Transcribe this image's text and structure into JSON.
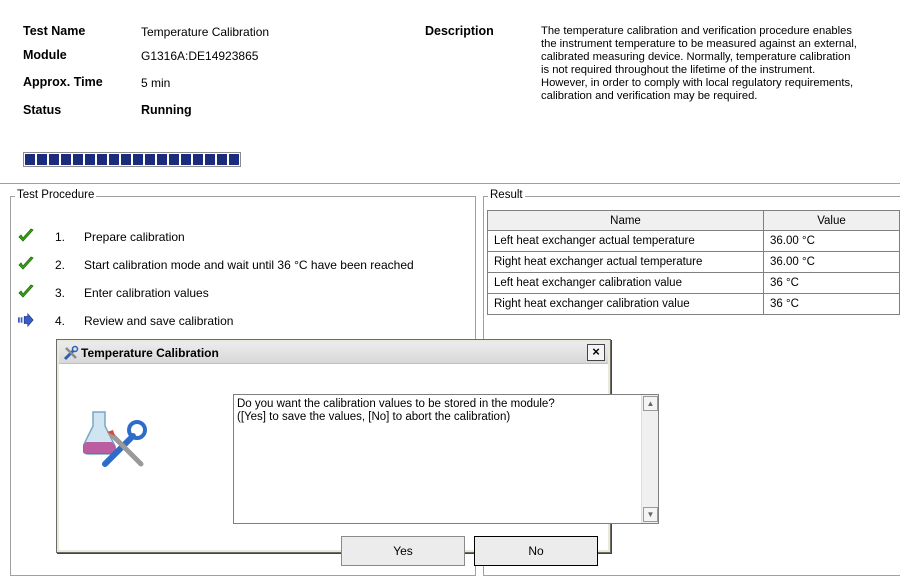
{
  "header": {
    "test_name_label": "Test Name",
    "test_name_value": "Temperature Calibration",
    "module_label": "Module",
    "module_value": "G1316A:DE14923865",
    "time_label": "Approx. Time",
    "time_value": "5 min",
    "status_label": "Status",
    "status_value": "Running",
    "description_label": "Description",
    "description_lines": [
      "The temperature calibration and verification procedure enables",
      "the instrument temperature to be measured against an external,",
      "calibrated measuring device. Normally, temperature calibration",
      "is not required throughout the lifetime of the instrument.",
      "However, in order to comply with local regulatory requirements,",
      "calibration and verification may be required."
    ],
    "progress_segments": 18,
    "progress_color": "#1b2b7e"
  },
  "procedure": {
    "title": "Test Procedure",
    "steps": [
      {
        "num": "1.",
        "text": "Prepare calibration",
        "icon": "check-icon"
      },
      {
        "num": "2.",
        "text": "Start calibration mode and wait until 36 °C have been reached",
        "icon": "check-icon"
      },
      {
        "num": "3.",
        "text": "Enter calibration values",
        "icon": "check-icon"
      },
      {
        "num": "4.",
        "text": "Review and save calibration",
        "icon": "current-step-arrow-icon"
      }
    ]
  },
  "result": {
    "title": "Result",
    "headers": [
      "Name",
      "Value"
    ],
    "rows": [
      [
        "Left heat exchanger actual temperature",
        "36.00 °C"
      ],
      [
        "Right heat exchanger actual temperature",
        "36.00 °C"
      ],
      [
        "Left heat exchanger calibration value",
        "36 °C"
      ],
      [
        "Right heat exchanger calibration value",
        "36 °C"
      ]
    ]
  },
  "dialog": {
    "title": "Temperature Calibration",
    "close_label": "×",
    "message_line1": "Do you want the calibration values to be stored in the module?",
    "message_line2": "([Yes] to save the values, [No] to abort the calibration)",
    "yes_label": "Yes",
    "no_label": "No"
  }
}
